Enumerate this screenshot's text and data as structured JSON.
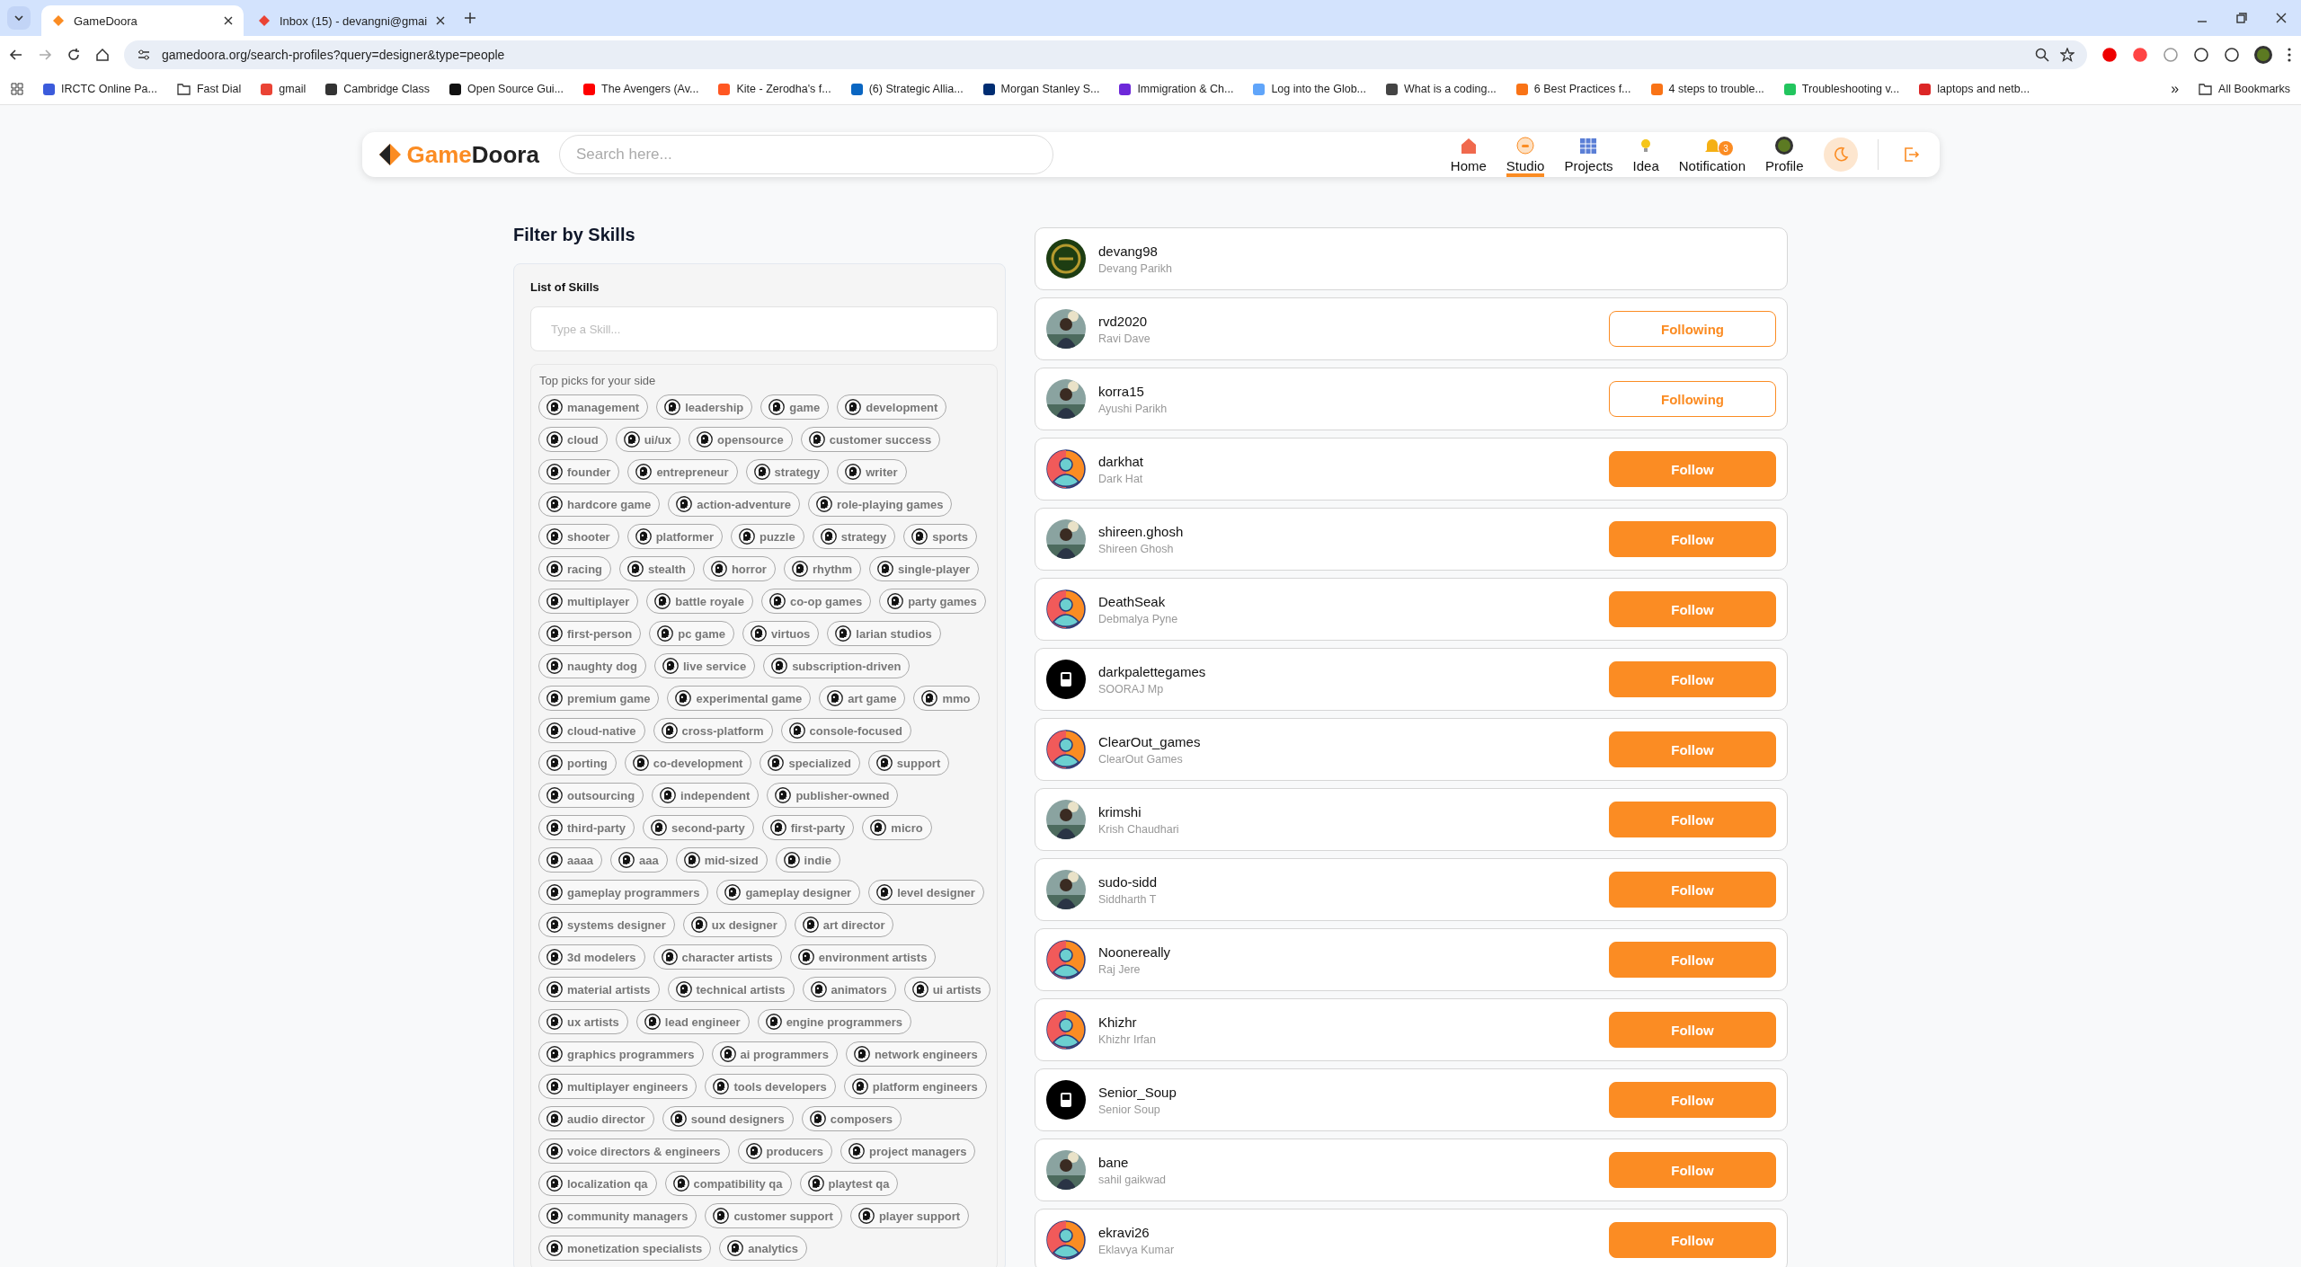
{
  "browser": {
    "tabs": [
      {
        "title": "GameDoora",
        "selected": true
      },
      {
        "title": "Inbox (15) - devangni@gmai",
        "selected": false
      }
    ],
    "url": "gamedoora.org/search-profiles?query=designer&type=people",
    "bookmarks": [
      {
        "kind": "site",
        "label": "IRCTC Online Pa..."
      },
      {
        "kind": "folder",
        "label": "Fast Dial"
      },
      {
        "kind": "site",
        "label": "gmail"
      },
      {
        "kind": "site",
        "label": "Cambridge Class"
      },
      {
        "kind": "site",
        "label": "Open Source Gui..."
      },
      {
        "kind": "site",
        "label": "The Avengers (Av..."
      },
      {
        "kind": "site",
        "label": "Kite - Zerodha's f..."
      },
      {
        "kind": "site",
        "label": "(6) Strategic Allia..."
      },
      {
        "kind": "site",
        "label": "Morgan Stanley S..."
      },
      {
        "kind": "site",
        "label": "Immigration & Ch..."
      },
      {
        "kind": "site",
        "label": "Log into the Glob..."
      },
      {
        "kind": "site",
        "label": "What is a coding..."
      },
      {
        "kind": "site",
        "label": "6 Best Practices f..."
      },
      {
        "kind": "site",
        "label": "4 steps to trouble..."
      },
      {
        "kind": "site",
        "label": "Troubleshooting v..."
      },
      {
        "kind": "site",
        "label": "laptops and netb..."
      }
    ],
    "more": "»",
    "all_bookmarks": "All Bookmarks"
  },
  "header": {
    "logo": {
      "part1": "Game",
      "part2": "Doora"
    },
    "search": {
      "placeholder": "Search here..."
    },
    "nav": [
      {
        "label": "Home",
        "selected": false
      },
      {
        "label": "Studio",
        "selected": true
      },
      {
        "label": "Projects",
        "selected": false
      },
      {
        "label": "Idea",
        "selected": false
      },
      {
        "label": "Notification",
        "selected": false,
        "badge": "3"
      },
      {
        "label": "Profile",
        "selected": false
      }
    ]
  },
  "filter": {
    "title": "Filter by Skills",
    "list_title": "List of Skills",
    "search": {
      "placeholder": "Type a Skill..."
    },
    "picks_title": "Top picks for your side",
    "skills": [
      "management",
      "leadership",
      "game",
      "development",
      "cloud",
      "ui/ux",
      "opensource",
      "customer success",
      "founder",
      "entrepreneur",
      "strategy",
      "writer",
      "hardcore game",
      "action-adventure",
      "role-playing games",
      "shooter",
      "platformer",
      "puzzle",
      "strategy",
      "sports",
      "racing",
      "stealth",
      "horror",
      "rhythm",
      "single-player",
      "multiplayer",
      "battle royale",
      "co-op games",
      "party games",
      "first-person",
      "pc game",
      "virtuos",
      "larian studios",
      "naughty dog",
      "live service",
      "subscription-driven",
      "premium game",
      "experimental game",
      "art game",
      "mmo",
      "cloud-native",
      "cross-platform",
      "console-focused",
      "porting",
      "co-development",
      "specialized",
      "support",
      "outsourcing",
      "independent",
      "publisher-owned",
      "third-party",
      "second-party",
      "first-party",
      "micro",
      "aaaa",
      "aaa",
      "mid-sized",
      "indie",
      "gameplay programmers",
      "gameplay designer",
      "level designer",
      "systems designer",
      "ux designer",
      "art director",
      "3d modelers",
      "character artists",
      "environment artists",
      "material artists",
      "technical artists",
      "animators",
      "ui artists",
      "ux artists",
      "lead engineer",
      "engine programmers",
      "graphics programmers",
      "ai programmers",
      "network engineers",
      "multiplayer engineers",
      "tools developers",
      "platform engineers",
      "audio director",
      "sound designers",
      "composers",
      "voice directors & engineers",
      "producers",
      "project managers",
      "localization qa",
      "compatibility qa",
      "playtest qa",
      "community managers",
      "customer support",
      "player support",
      "monetization specialists",
      "analytics"
    ]
  },
  "profiles": [
    {
      "username": "devang98",
      "name": "Devang Parikh",
      "avatar": {
        "kind": "logo"
      }
    },
    {
      "username": "rvd2020",
      "name": "Ravi Dave",
      "button": {
        "kind": "following",
        "label": "Following"
      }
    },
    {
      "username": "korra15",
      "name": "Ayushi Parikh",
      "button": {
        "kind": "following",
        "label": "Following"
      }
    },
    {
      "username": "darkhat",
      "name": "Dark Hat",
      "avatar": {
        "kind": "default"
      },
      "button": {
        "kind": "follow",
        "label": "Follow"
      }
    },
    {
      "username": "shireen.ghosh",
      "name": "Shireen Ghosh",
      "button": {
        "kind": "follow",
        "label": "Follow"
      }
    },
    {
      "username": "DeathSeak",
      "name": "Debmalya Pyne",
      "avatar": {
        "kind": "default"
      },
      "button": {
        "kind": "follow",
        "label": "Follow"
      }
    },
    {
      "username": "darkpalettegames",
      "name": "SOORAJ Mp",
      "avatar": {
        "kind": "dark"
      },
      "button": {
        "kind": "follow",
        "label": "Follow"
      }
    },
    {
      "username": "ClearOut_games",
      "name": "ClearOut Games",
      "avatar": {
        "kind": "default"
      },
      "button": {
        "kind": "follow",
        "label": "Follow"
      }
    },
    {
      "username": "krimshi",
      "name": "Krish Chaudhari",
      "button": {
        "kind": "follow",
        "label": "Follow"
      }
    },
    {
      "username": "sudo-sidd",
      "name": "Siddharth T",
      "button": {
        "kind": "follow",
        "label": "Follow"
      }
    },
    {
      "username": "Noonereally",
      "name": "Raj Jere",
      "avatar": {
        "kind": "default"
      },
      "button": {
        "kind": "follow",
        "label": "Follow"
      }
    },
    {
      "username": "Khizhr",
      "name": "Khizhr Irfan",
      "avatar": {
        "kind": "default"
      },
      "button": {
        "kind": "follow",
        "label": "Follow"
      }
    },
    {
      "username": "Senior_Soup",
      "name": "Senior Soup",
      "avatar": {
        "kind": "dark"
      },
      "button": {
        "kind": "follow",
        "label": "Follow"
      }
    },
    {
      "username": "bane",
      "name": "sahil gaikwad",
      "button": {
        "kind": "follow",
        "label": "Follow"
      }
    },
    {
      "username": "ekravi26",
      "name": "Eklavya Kumar",
      "avatar": {
        "kind": "default"
      },
      "button": {
        "kind": "follow",
        "label": "Follow"
      }
    }
  ]
}
